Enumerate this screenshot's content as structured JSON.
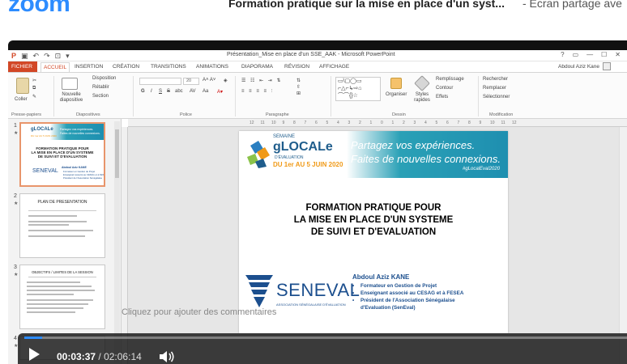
{
  "header": {
    "logo_text": "zoom",
    "title": "Formation pratique sur la mise en place d'un syst...",
    "subtitle": "- Écran partage ave"
  },
  "ppt": {
    "window_title": "Présentation_Mise en place d'un SSE_AAK - Microsoft PowerPoint",
    "win_help": "?",
    "win_min": "—",
    "win_max": "☐",
    "win_close": "✕",
    "user": "Abdoul Aziz Kane",
    "tabs": [
      "FICHIER",
      "ACCUEIL",
      "INSERTION",
      "CRÉATION",
      "TRANSITIONS",
      "ANIMATIONS",
      "DIAPORAMA",
      "RÉVISION",
      "AFFICHAGE"
    ],
    "ribbon": {
      "clipboard_label": "Presse-papiers",
      "paste": "Coller",
      "new_slide": "Nouvelle diapositive",
      "layout": "Disposition",
      "reset": "Rétablir",
      "section": "Section",
      "slides_label": "Diapositives",
      "font_label": "Police",
      "font_size": "20",
      "paragraph_label": "Paragraphe",
      "drawing_label": "Dessin",
      "arrange": "Organiser",
      "styles": "Styles rapides",
      "fill": "Remplissage",
      "outline": "Contour",
      "effects": "Effets",
      "find": "Rechercher",
      "replace": "Remplacer",
      "select": "Sélectionner",
      "editing_label": "Modification"
    },
    "ruler_marks": [
      "12",
      "11",
      "10",
      "9",
      "8",
      "7",
      "6",
      "5",
      "4",
      "3",
      "2",
      "1",
      "0",
      "1",
      "2",
      "3",
      "4",
      "5",
      "6",
      "7",
      "8",
      "9",
      "10",
      "11",
      "12"
    ],
    "thumbs": [
      {
        "num": "1",
        "star": "★"
      },
      {
        "num": "2",
        "star": "★",
        "title": "PLAN DE PRESENTATION"
      },
      {
        "num": "3",
        "star": "★",
        "title": "OBJECTIFS / LIMITES DE LA SESSION"
      },
      {
        "num": "4",
        "star": "★"
      }
    ],
    "notes_hint": "Cliquez pour ajouter des commentaires"
  },
  "slide": {
    "banner": {
      "semaine": "SEMAINE",
      "glocale": "gLOCALe",
      "deval": "D'ÉVALUATION",
      "dates": "DU 1er AU 5 JUIN 2020",
      "tag1": "Partagez vos expériences.",
      "tag2": "Faites de nouvelles connexions.",
      "hashtag": "#gLocalEval2020"
    },
    "title_l1": "FORMATION PRATIQUE POUR",
    "title_l2": "LA MISE EN PLACE D'UN SYSTEME",
    "title_l3": "DE SUIVI ET D'EVALUATION",
    "logo_word": "SENEVAL",
    "logo_sub": "ASSOCIATION SÉNÉGALAISE D'ÉVALUATION",
    "author": "Abdoul Aziz KANE",
    "bullets": [
      "Formateur en Gestion de Projet",
      "Enseignant associé au CESAG et à FESEA",
      "Président de l'Association Sénégalaise",
      "d'Evaluation (SenEval)"
    ]
  },
  "video": {
    "current": "00:03:37",
    "separator": "/",
    "duration": "02:06:14",
    "progress": 0.029
  },
  "colors": {
    "ppt_accent": "#d24726",
    "zoom_blue": "#2d8cff",
    "seneval_blue": "#1c4f8e",
    "banner_teal": "#2aa0b6",
    "dates_orange": "#f09a18"
  }
}
